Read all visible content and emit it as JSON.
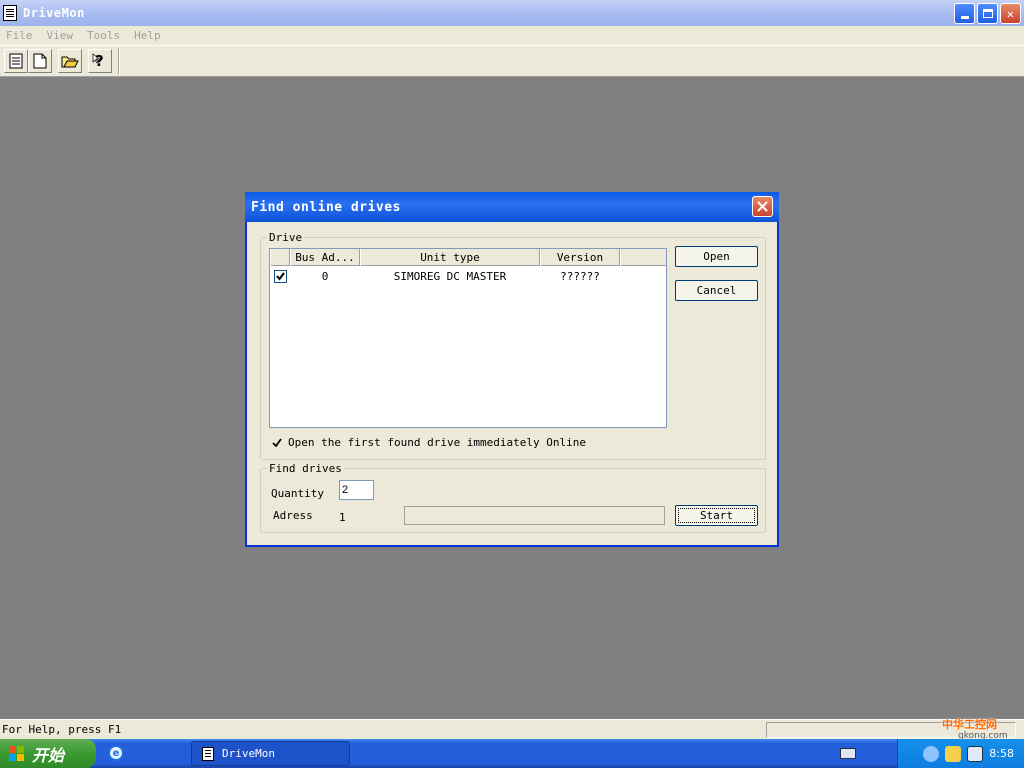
{
  "window": {
    "title": "DriveMon"
  },
  "menu": [
    {
      "label": "File"
    },
    {
      "label": "View"
    },
    {
      "label": "Tools"
    },
    {
      "label": "Help"
    }
  ],
  "dialog": {
    "title": "Find online drives",
    "drive_group": "Drive",
    "columns": [
      "Bus Ad...",
      "Unit type",
      "Version"
    ],
    "rows": [
      {
        "bus": "0",
        "unit_type": "SIMOREG DC MASTER",
        "version": "??????",
        "checked": true
      }
    ],
    "open_first_label": "Open the first found drive immediately Online",
    "open_button": "Open",
    "cancel_button": "Cancel",
    "find_group": "Find drives",
    "quantity_label": "Quantity",
    "quantity_value": "2",
    "adress_label": "Adress",
    "adress_value": "1",
    "start_button": "Start"
  },
  "status": {
    "text": "For Help, press F1"
  },
  "taskbar": {
    "start_label": "开始",
    "task_label": "DriveMon",
    "clock": "8:58"
  },
  "watermark": {
    "text": "中华工控网",
    "url": "gkong.com"
  }
}
